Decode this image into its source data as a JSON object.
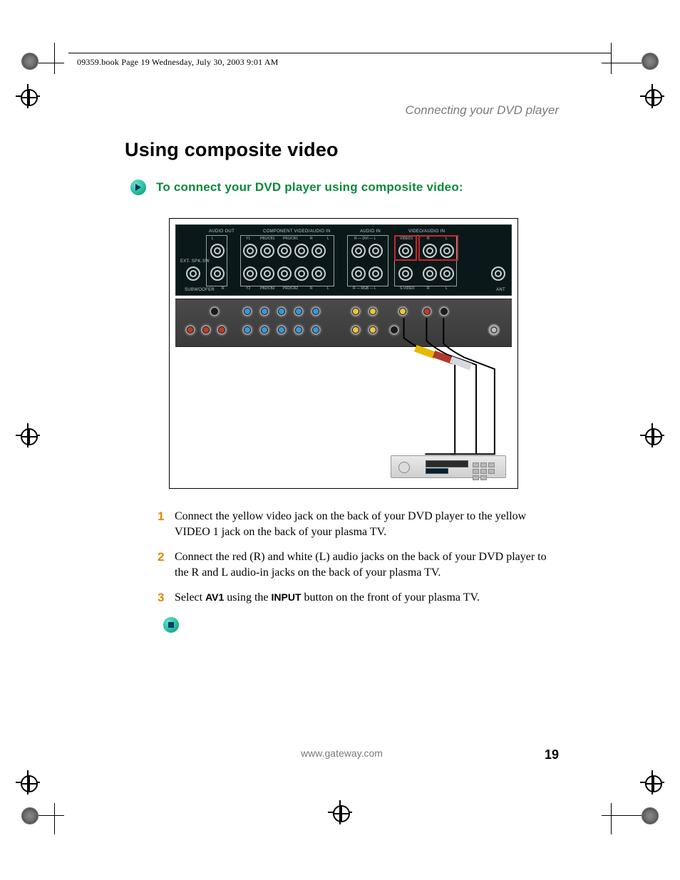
{
  "header": {
    "running_head": "09359.book  Page 19  Wednesday, July 30, 2003  9:01 AM",
    "chapter": "Connecting your DVD player"
  },
  "title": "Using composite video",
  "procedure_heading": "To connect your DVD player using composite video:",
  "panel_labels": {
    "audio_out": "AUDIO OUT",
    "component": "COMPONENT VIDEO/AUDIO IN",
    "audio_in": "AUDIO IN",
    "video_audio_in": "VIDEO/AUDIO IN",
    "ext_spk_sw": "EXT. SPK.SW",
    "subwoofer": "SUBWOOFER",
    "ant": "ANT",
    "L": "L",
    "R": "R",
    "Y1": "Y1",
    "Y2": "Y2",
    "Pb1": "PB1/CB1",
    "Pr1": "PR1/CR1",
    "Pb2": "PB2/CB2",
    "Pr2": "PR2/CR2",
    "r_dvi_l": "R — DVI — L",
    "r_rgb_l": "R — RGB — L",
    "video1": "VIDEO1",
    "svideo": "S-VIDEO"
  },
  "steps": [
    {
      "num": "1",
      "text": "Connect the yellow video jack on the back of your DVD player to the yellow VIDEO 1 jack on the back of your plasma TV."
    },
    {
      "num": "2",
      "text": "Connect the red (R) and white (L) audio jacks on the back of your DVD player to the R and L audio-in jacks on the back of your plasma TV."
    },
    {
      "num": "3",
      "text_parts": [
        "Select ",
        "AV1",
        " using the ",
        "INPUT",
        " button on the front of your plasma TV."
      ]
    }
  ],
  "footer": {
    "url": "www.gateway.com",
    "page_number": "19"
  }
}
